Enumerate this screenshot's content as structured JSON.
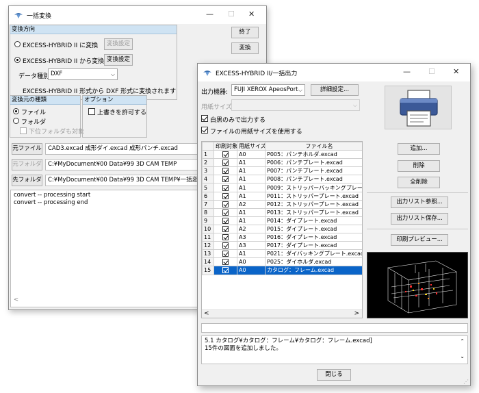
{
  "bg_window": {
    "title": "一括変換",
    "minimize": "—",
    "maximize": "☐",
    "close": "✕",
    "direction_header": "変換方向",
    "radio_to_label": "EXCESS-HYBRID II に変換",
    "radio_to_settings": "変換設定",
    "radio_from_label": "EXCESS-HYBRID II から変換",
    "radio_from_settings": "変換設定",
    "data_type_label": "データ種別",
    "data_type_value": "DXF",
    "conversion_note": "EXCESS-HYBRID II 形式から DXF 形式に変換されます",
    "exit_button": "終了",
    "convert_button": "変換",
    "source_header": "変換元の種類",
    "source_file": "ファイル",
    "source_folder": "フォルダ",
    "subfolder": "下位フォルダも対象",
    "options_header": "オプション",
    "overwrite": "上書きを許可する",
    "src_file_button": "元ファイル",
    "src_file_value": "CAD3.excad 成形ダイ.excad 成形パンチ.excad",
    "src_folder_button": "元フォルダ",
    "src_folder_value": "C:¥MyDocument¥00 Data¥99 3D CAM TEMP",
    "dest_folder_button": "先フォルダ",
    "dest_folder_value": "C:¥MyDocument¥00 Data¥99 3D CAM TEMP¥一括変換",
    "log_lines": [
      "convert -- processing start",
      "convert -- processing end"
    ],
    "scroll_left": "<"
  },
  "fg_window": {
    "title": "EXCESS-HYBRID II/一括出力",
    "minimize": "—",
    "maximize": "☐",
    "close": "✕",
    "device_label": "出力機器:",
    "device_value": "FUJI XEROX ApeosPort",
    "detail_button": "詳細設定...",
    "paper_label": "用紙サイズ:",
    "bw_output": "白黒のみで出力する",
    "use_paper_size": "ファイルの用紙サイズを使用する",
    "columns": [
      "",
      "印刷対象",
      "用紙サイズ",
      "ファイル名"
    ],
    "rows": [
      {
        "no": "1",
        "size": "A0",
        "file": "P005：パンチホルダ.excad",
        "selected": false
      },
      {
        "no": "2",
        "size": "A1",
        "file": "P006：パンチプレート.excad",
        "selected": false
      },
      {
        "no": "3",
        "size": "A1",
        "file": "P007：パンチプレート.excad",
        "selected": false
      },
      {
        "no": "4",
        "size": "A1",
        "file": "P008：パンチプレート.excad",
        "selected": false
      },
      {
        "no": "5",
        "size": "A1",
        "file": "P009：ストリッパーバッキングプレート.excad",
        "selected": false
      },
      {
        "no": "6",
        "size": "A1",
        "file": "P011：ストリッパープレート.excad",
        "selected": false
      },
      {
        "no": "7",
        "size": "A2",
        "file": "P012：ストリッパープレート.excad",
        "selected": false
      },
      {
        "no": "8",
        "size": "A1",
        "file": "P013：ストリッパープレート.excad",
        "selected": false
      },
      {
        "no": "9",
        "size": "A1",
        "file": "P014：ダイプレート.excad",
        "selected": false
      },
      {
        "no": "10",
        "size": "A2",
        "file": "P015：ダイプレート.excad",
        "selected": false
      },
      {
        "no": "11",
        "size": "A3",
        "file": "P016：ダイプレート.excad",
        "selected": false
      },
      {
        "no": "12",
        "size": "A3",
        "file": "P017：ダイプレート.excad",
        "selected": false
      },
      {
        "no": "13",
        "size": "A1",
        "file": "P021：ダイバッキングプレート.excad",
        "selected": false
      },
      {
        "no": "14",
        "size": "A0",
        "file": "P025：ダイホルダ.excad",
        "selected": false
      },
      {
        "no": "15",
        "size": "A0",
        "file": "カタログ：フレーム.excad",
        "selected": true
      }
    ],
    "scroll_left": "<",
    "scroll_right": ">",
    "add_button": "追加...",
    "delete_button": "削除",
    "delete_all_button": "全削除",
    "list_ref_button": "出力リスト参照...",
    "list_save_button": "出力リスト保存...",
    "preview_button": "印刷プレビュー...",
    "status_lines": [
      "5.1 カタログ¥カタログ：フレーム¥カタログ：フレーム.excad]",
      "15件の図面を追加しました。"
    ],
    "close_button": "閉じる"
  }
}
